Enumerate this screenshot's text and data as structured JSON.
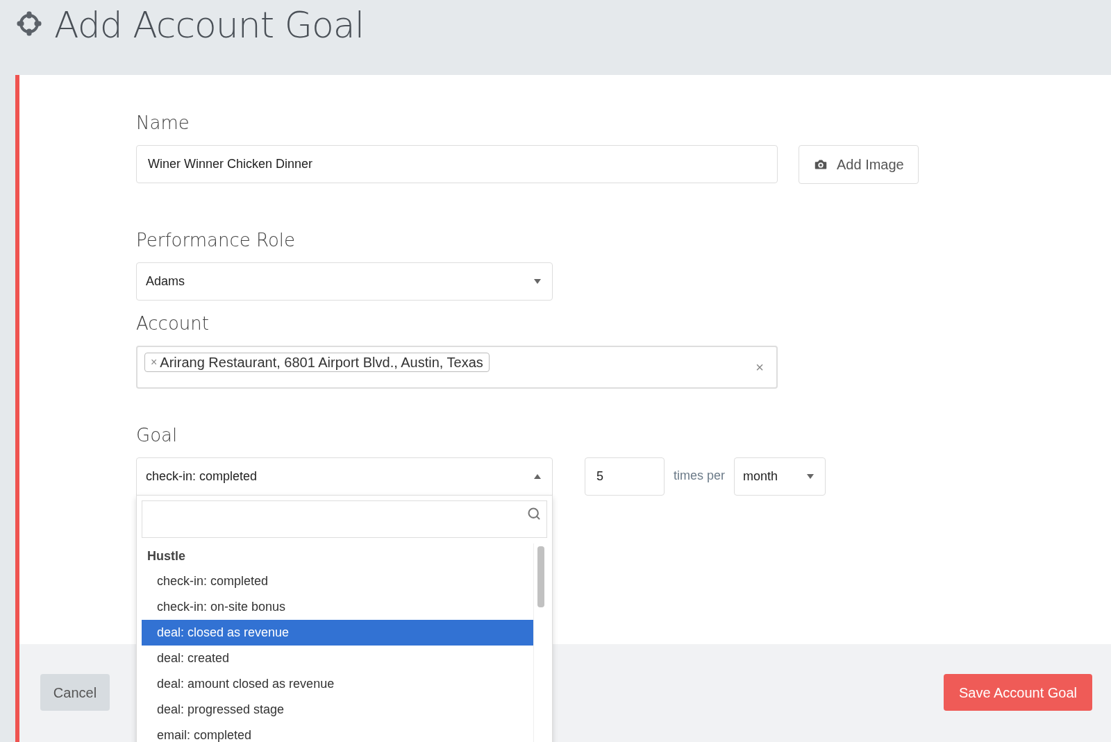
{
  "header": {
    "title": "Add Account Goal"
  },
  "name_field": {
    "label": "Name",
    "value": "Winer Winner Chicken Dinner"
  },
  "add_image_button": "Add Image",
  "performance_role": {
    "label": "Performance Role",
    "value": "Adams"
  },
  "account": {
    "label": "Account",
    "tags": [
      "Arirang Restaurant, 6801 Airport Blvd., Austin, Texas"
    ],
    "clear": "×",
    "tag_remove": "×"
  },
  "goal": {
    "label": "Goal",
    "value": "check-in: completed",
    "expanded": true,
    "count": "5",
    "times_per": "times per",
    "period": "month",
    "dropdown": {
      "groups": [
        {
          "label": "Hustle",
          "options": [
            {
              "label": "check-in: completed",
              "selected": false
            },
            {
              "label": "check-in: on-site bonus",
              "selected": false
            },
            {
              "label": "deal: closed as revenue",
              "selected": true
            },
            {
              "label": "deal: created",
              "selected": false
            },
            {
              "label": "deal: amount closed as revenue",
              "selected": false
            },
            {
              "label": "deal: progressed stage",
              "selected": false
            },
            {
              "label": "email: completed",
              "selected": false
            }
          ]
        }
      ]
    }
  },
  "footer": {
    "cancel": "Cancel",
    "save": "Save Account Goal"
  }
}
